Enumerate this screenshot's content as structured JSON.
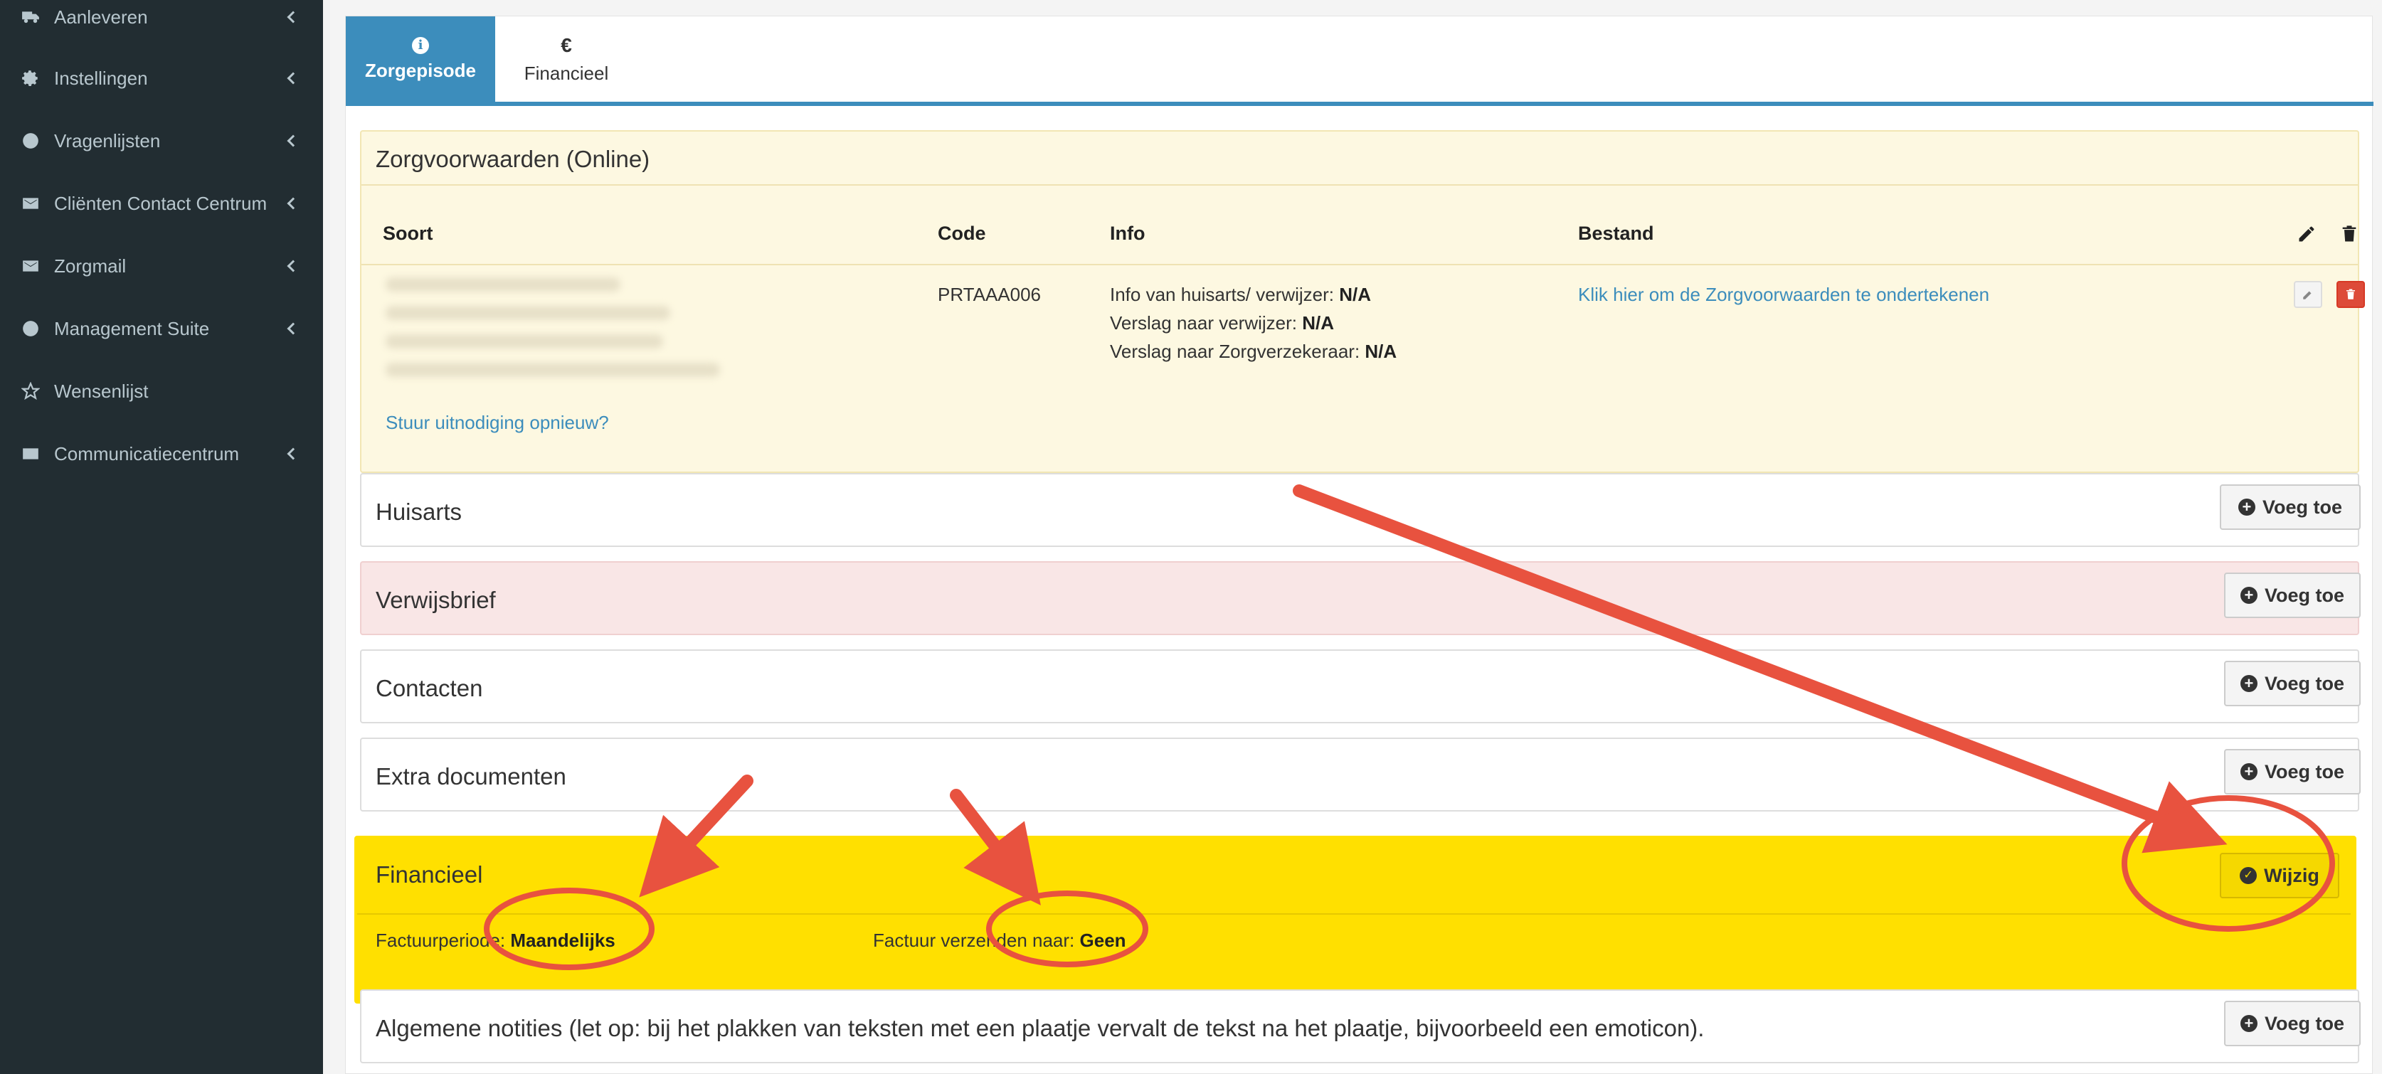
{
  "sidebar": {
    "items": [
      {
        "label": "Aanleveren",
        "icon": "truck-icon"
      },
      {
        "label": "Instellingen",
        "icon": "gear-icon"
      },
      {
        "label": "Vragenlijsten",
        "icon": "globe-icon"
      },
      {
        "label": "Cliënten Contact Centrum",
        "icon": "envelope-icon"
      },
      {
        "label": "Zorgmail",
        "icon": "envelope-icon"
      },
      {
        "label": "Management Suite",
        "icon": "globe-icon"
      },
      {
        "label": "Wensenlijst",
        "icon": "star-icon"
      },
      {
        "label": "Communicatiecentrum",
        "icon": "envelope-icon"
      }
    ]
  },
  "tabs": {
    "zorgepisode": {
      "label": "Zorgepisode",
      "icon": "info-icon",
      "icon_text": "i"
    },
    "financieel": {
      "label": "Financieel",
      "icon": "euro-icon",
      "icon_text": "€"
    }
  },
  "zorgvoorwaarden": {
    "title": "Zorgvoorwaarden (Online)",
    "headers": {
      "soort": "Soort",
      "code": "Code",
      "info": "Info",
      "bestand": "Bestand"
    },
    "code": "PRTAAA006",
    "info_lines": [
      {
        "label": "Info van huisarts/ verwijzer:",
        "value": "N/A"
      },
      {
        "label": "Verslag naar verwijzer:",
        "value": "N/A"
      },
      {
        "label": "Verslag naar Zorgverzekeraar:",
        "value": "N/A"
      }
    ],
    "bestand_link": "Klik hier om de Zorgvoorwaarden te ondertekenen",
    "resend_link": "Stuur uitnodiging opnieuw?"
  },
  "panels": {
    "huisarts": {
      "title": "Huisarts",
      "button": "Voeg toe"
    },
    "verwijsbrief": {
      "title": "Verwijsbrief",
      "button": "Voeg toe"
    },
    "contacten": {
      "title": "Contacten",
      "button": "Voeg toe"
    },
    "extra": {
      "title": "Extra documenten",
      "button": "Voeg toe"
    },
    "financieel": {
      "title": "Financieel",
      "button": "Wijzig",
      "factuurperiode_label": "Factuurperiode:",
      "factuurperiode_value": "Maandelijks",
      "verzenden_label": "Factuur verzenden naar:",
      "verzenden_value": "Geen"
    },
    "notities": {
      "title": "Algemene notities (let op: bij het plakken van teksten met een plaatje vervalt de tekst na het plaatje, bijvoorbeeld een emoticon).",
      "button": "Voeg toe"
    }
  },
  "colors": {
    "sidebar_bg": "#222d32",
    "tab_active": "#3c8dbc",
    "highlight": "#ffe000",
    "annotation": "#e8523f"
  }
}
